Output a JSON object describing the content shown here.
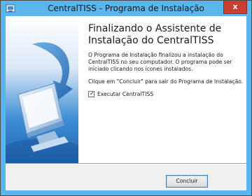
{
  "window": {
    "title": "CentralTISS - Programa de Instalação",
    "app_icon": "installer-icon",
    "close_icon": "close-icon",
    "close_glyph": "x"
  },
  "banner": {
    "illustration": "monitor-with-arrow-graphic"
  },
  "content": {
    "heading": "Finalizando o Assistente de Instalação do CentralTISS",
    "paragraph1": "O Programa de Instalação finalizou a instalação do CentralTISS no seu computador. O programa pode ser iniciado clicando nos ícones instalados.",
    "paragraph2": "Clique em \"Concluir\" para sair do Programa de Instalação.",
    "checkbox_label": "Executar CentralTISS",
    "checkbox_checked": true,
    "checkmark_glyph": "✓"
  },
  "footer": {
    "finish_label": "Concluir"
  },
  "colors": {
    "titlebar": "#5ab6ec",
    "close_button": "#c84031",
    "banner_accent": "#2a7fc9"
  }
}
